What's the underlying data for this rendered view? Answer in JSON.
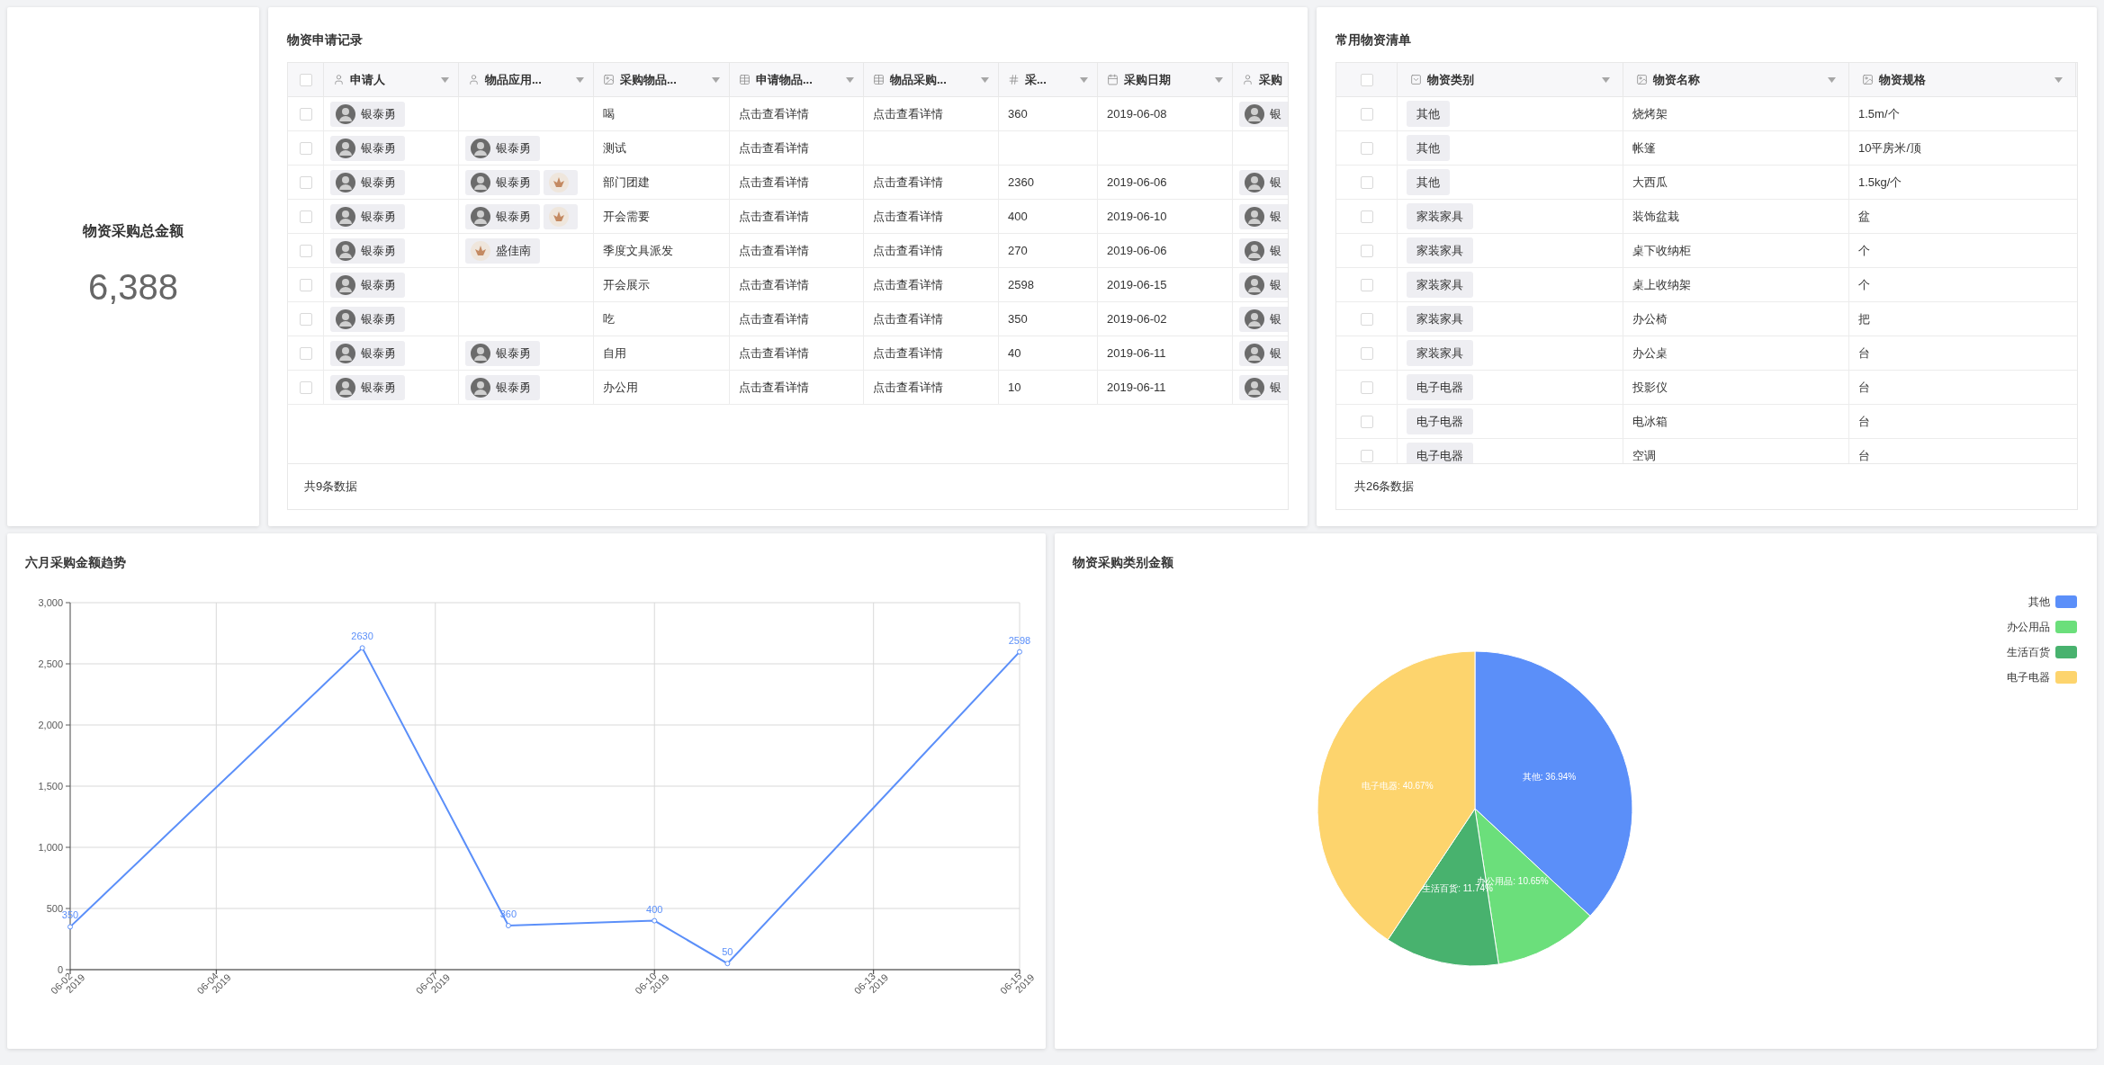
{
  "summary": {
    "title": "物资采购总金额",
    "value": "6,388"
  },
  "requests": {
    "title": "物资申请记录",
    "header_checked": false,
    "columns": [
      {
        "label": "申请人"
      },
      {
        "label": "物品应用..."
      },
      {
        "label": "采购物品..."
      },
      {
        "label": "申请物品..."
      },
      {
        "label": "物品采购..."
      },
      {
        "label": "采..."
      },
      {
        "label": "采购日期"
      },
      {
        "label": "采购"
      }
    ],
    "rows": [
      {
        "checked": false,
        "cells": [
          {
            "kind": "people",
            "people": [
              {
                "name": "银泰勇",
                "kind": "gray"
              }
            ]
          },
          {
            "kind": "empty"
          },
          {
            "kind": "text",
            "text": "喝"
          },
          {
            "kind": "text",
            "text": "点击查看详情"
          },
          {
            "kind": "text",
            "text": "点击查看详情"
          },
          {
            "kind": "text",
            "text": "360"
          },
          {
            "kind": "text",
            "text": "2019-06-08"
          },
          {
            "kind": "people",
            "people": [
              {
                "name": "银",
                "kind": "gray"
              }
            ]
          }
        ]
      },
      {
        "checked": false,
        "cells": [
          {
            "kind": "people",
            "people": [
              {
                "name": "银泰勇",
                "kind": "gray"
              }
            ]
          },
          {
            "kind": "people",
            "people": [
              {
                "name": "银泰勇",
                "kind": "gray"
              }
            ]
          },
          {
            "kind": "text",
            "text": "测试"
          },
          {
            "kind": "text",
            "text": "点击查看详情"
          },
          {
            "kind": "empty"
          },
          {
            "kind": "empty"
          },
          {
            "kind": "empty"
          },
          {
            "kind": "empty"
          }
        ]
      },
      {
        "checked": false,
        "cells": [
          {
            "kind": "people",
            "people": [
              {
                "name": "银泰勇",
                "kind": "gray"
              }
            ]
          },
          {
            "kind": "people",
            "people": [
              {
                "name": "银泰勇",
                "kind": "gray"
              },
              {
                "kind": "flower"
              }
            ]
          },
          {
            "kind": "text",
            "text": "部门团建"
          },
          {
            "kind": "text",
            "text": "点击查看详情"
          },
          {
            "kind": "text",
            "text": "点击查看详情"
          },
          {
            "kind": "text",
            "text": "2360"
          },
          {
            "kind": "text",
            "text": "2019-06-06"
          },
          {
            "kind": "people",
            "people": [
              {
                "name": "银",
                "kind": "gray"
              }
            ]
          }
        ]
      },
      {
        "checked": false,
        "cells": [
          {
            "kind": "people",
            "people": [
              {
                "name": "银泰勇",
                "kind": "gray"
              }
            ]
          },
          {
            "kind": "people",
            "people": [
              {
                "name": "银泰勇",
                "kind": "gray"
              },
              {
                "kind": "flower"
              }
            ]
          },
          {
            "kind": "text",
            "text": "开会需要"
          },
          {
            "kind": "text",
            "text": "点击查看详情"
          },
          {
            "kind": "text",
            "text": "点击查看详情"
          },
          {
            "kind": "text",
            "text": "400"
          },
          {
            "kind": "text",
            "text": "2019-06-10"
          },
          {
            "kind": "people",
            "people": [
              {
                "name": "银",
                "kind": "gray"
              }
            ]
          }
        ]
      },
      {
        "checked": false,
        "cells": [
          {
            "kind": "people",
            "people": [
              {
                "name": "银泰勇",
                "kind": "gray"
              }
            ]
          },
          {
            "kind": "people",
            "people": [
              {
                "name": "盛佳南",
                "kind": "flower"
              }
            ]
          },
          {
            "kind": "text",
            "text": "季度文具派发"
          },
          {
            "kind": "text",
            "text": "点击查看详情"
          },
          {
            "kind": "text",
            "text": "点击查看详情"
          },
          {
            "kind": "text",
            "text": "270"
          },
          {
            "kind": "text",
            "text": "2019-06-06"
          },
          {
            "kind": "people",
            "people": [
              {
                "name": "银",
                "kind": "gray"
              }
            ]
          }
        ]
      },
      {
        "checked": false,
        "cells": [
          {
            "kind": "people",
            "people": [
              {
                "name": "银泰勇",
                "kind": "gray"
              }
            ]
          },
          {
            "kind": "empty"
          },
          {
            "kind": "text",
            "text": "开会展示"
          },
          {
            "kind": "text",
            "text": "点击查看详情"
          },
          {
            "kind": "text",
            "text": "点击查看详情"
          },
          {
            "kind": "text",
            "text": "2598"
          },
          {
            "kind": "text",
            "text": "2019-06-15"
          },
          {
            "kind": "people",
            "people": [
              {
                "name": "银",
                "kind": "gray"
              }
            ]
          }
        ]
      },
      {
        "checked": false,
        "cells": [
          {
            "kind": "people",
            "people": [
              {
                "name": "银泰勇",
                "kind": "gray"
              }
            ]
          },
          {
            "kind": "empty"
          },
          {
            "kind": "text",
            "text": "吃"
          },
          {
            "kind": "text",
            "text": "点击查看详情"
          },
          {
            "kind": "text",
            "text": "点击查看详情"
          },
          {
            "kind": "text",
            "text": "350"
          },
          {
            "kind": "text",
            "text": "2019-06-02"
          },
          {
            "kind": "people",
            "people": [
              {
                "name": "银",
                "kind": "gray"
              }
            ]
          }
        ]
      },
      {
        "checked": false,
        "cells": [
          {
            "kind": "people",
            "people": [
              {
                "name": "银泰勇",
                "kind": "gray"
              }
            ]
          },
          {
            "kind": "people",
            "people": [
              {
                "name": "银泰勇",
                "kind": "gray"
              }
            ]
          },
          {
            "kind": "text",
            "text": "自用"
          },
          {
            "kind": "text",
            "text": "点击查看详情"
          },
          {
            "kind": "text",
            "text": "点击查看详情"
          },
          {
            "kind": "text",
            "text": "40"
          },
          {
            "kind": "text",
            "text": "2019-06-11"
          },
          {
            "kind": "people",
            "people": [
              {
                "name": "银",
                "kind": "gray"
              }
            ]
          }
        ]
      },
      {
        "checked": false,
        "cells": [
          {
            "kind": "people",
            "people": [
              {
                "name": "银泰勇",
                "kind": "gray"
              }
            ]
          },
          {
            "kind": "people",
            "people": [
              {
                "name": "银泰勇",
                "kind": "gray"
              }
            ]
          },
          {
            "kind": "text",
            "text": "办公用"
          },
          {
            "kind": "text",
            "text": "点击查看详情"
          },
          {
            "kind": "text",
            "text": "点击查看详情"
          },
          {
            "kind": "text",
            "text": "10"
          },
          {
            "kind": "text",
            "text": "2019-06-11"
          },
          {
            "kind": "people",
            "people": [
              {
                "name": "银",
                "kind": "gray"
              }
            ]
          }
        ]
      }
    ],
    "footer": "共9条数据"
  },
  "catalog": {
    "title": "常用物资清单",
    "header_checked": false,
    "columns": [
      {
        "label": "物资类别"
      },
      {
        "label": "物资名称"
      },
      {
        "label": "物资规格"
      }
    ],
    "rows": [
      {
        "checked": false,
        "category": "其他",
        "name": "烧烤架",
        "spec": "1.5m/个"
      },
      {
        "checked": false,
        "category": "其他",
        "name": "帐篷",
        "spec": "10平房米/顶"
      },
      {
        "checked": false,
        "category": "其他",
        "name": "大西瓜",
        "spec": "1.5kg/个"
      },
      {
        "checked": false,
        "category": "家装家具",
        "name": "装饰盆栽",
        "spec": "盆"
      },
      {
        "checked": false,
        "category": "家装家具",
        "name": "桌下收纳柜",
        "spec": "个"
      },
      {
        "checked": false,
        "category": "家装家具",
        "name": "桌上收纳架",
        "spec": "个"
      },
      {
        "checked": false,
        "category": "家装家具",
        "name": "办公椅",
        "spec": "把"
      },
      {
        "checked": false,
        "category": "家装家具",
        "name": "办公桌",
        "spec": "台"
      },
      {
        "checked": false,
        "category": "电子电器",
        "name": "投影仪",
        "spec": "台"
      },
      {
        "checked": false,
        "category": "电子电器",
        "name": "电冰箱",
        "spec": "台"
      },
      {
        "checked": false,
        "category": "电子电器",
        "name": "空调",
        "spec": "台"
      }
    ],
    "footer": "共26条数据"
  },
  "trend": {
    "title": "六月采购金额趋势",
    "chart_data": {
      "type": "line",
      "x": [
        "2019-06-02",
        "2019-06-06",
        "2019-06-08",
        "2019-06-10",
        "2019-06-11",
        "2019-06-15"
      ],
      "series": [
        {
          "color": "#5b8ff9",
          "marker": true,
          "values": [
            350,
            2630,
            360,
            400,
            50,
            2598
          ]
        }
      ],
      "xlim": [
        "2019-06-02",
        "2019-06-15"
      ],
      "ylim": [
        0,
        3000
      ],
      "xticks": [
        {
          "value": "2019-06-02",
          "label": "06-02 2019"
        },
        {
          "value": "2019-06-04",
          "label": "06-04 2019"
        },
        {
          "value": "2019-06-07",
          "label": "06-07 2019"
        },
        {
          "value": "2019-06-10",
          "label": "06-10 2019"
        },
        {
          "value": "2019-06-13",
          "label": "06-13 2019"
        },
        {
          "value": "2019-06-15",
          "label": "06-15 2019"
        }
      ],
      "yticks": [
        {
          "value": 0,
          "label": "0"
        },
        {
          "value": 500,
          "label": "500"
        },
        {
          "value": 1000,
          "label": "1,000"
        },
        {
          "value": 1500,
          "label": "1,500"
        },
        {
          "value": 2000,
          "label": "2,000"
        },
        {
          "value": 2500,
          "label": "2,500"
        },
        {
          "value": 3000,
          "label": "3,000"
        }
      ],
      "grid": true,
      "data_labels": true
    }
  },
  "categories": {
    "title": "物资采购类别金额",
    "chart_data": {
      "type": "pie",
      "categories": [
        "其他",
        "办公用品",
        "生活百货",
        "电子电器"
      ],
      "series": [
        {
          "values": [
            36.94,
            10.65,
            11.74,
            40.67
          ]
        }
      ],
      "legend": "top-right",
      "value_labels": [
        "其他: 36.94%",
        "办公用品: 10.65%",
        "生活百货: 11.74%",
        "电子电器: 40.67%"
      ]
    }
  }
}
